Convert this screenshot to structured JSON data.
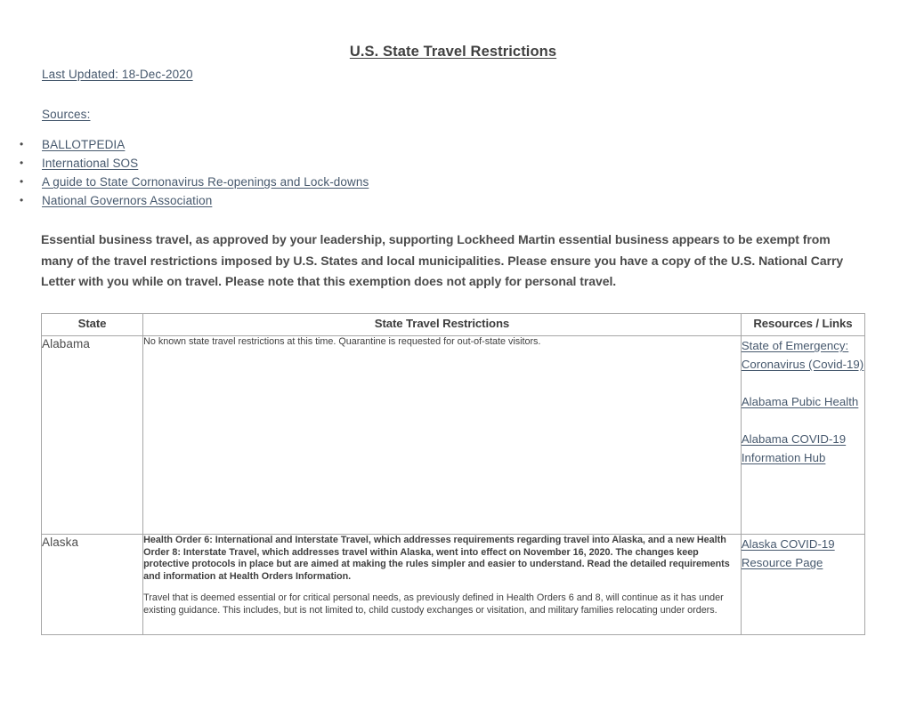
{
  "document": {
    "title": "U.S. State Travel Restrictions",
    "last_updated": "Last Updated: 18-Dec-2020",
    "sources_label": "Sources:",
    "sources": [
      {
        "label": "BALLOTPEDIA"
      },
      {
        "label": "International SOS"
      },
      {
        "label": "A guide to State Cornonavirus Re-openings and Lock-downs"
      },
      {
        "label": "National Governors Association"
      }
    ],
    "notice": "Essential business travel, as approved by your leadership, supporting Lockheed Martin essential business appears to be exempt from many of the travel restrictions imposed by U.S. States and local municipalities.  Please ensure you have a copy of the U.S. National Carry Letter with you while on travel.   Please note that this exemption does not apply for personal travel."
  },
  "table": {
    "headers": {
      "state": "State",
      "restrictions": "State Travel Restrictions",
      "resources": "Resources / Links"
    },
    "rows": [
      {
        "state": "Alabama",
        "restrictions": {
          "p1": "No known state travel restrictions at this time. Quarantine is requested for out-of-state visitors."
        },
        "links": [
          {
            "label": "State of Emergency: Coronavirus (Covid-19)"
          },
          {
            "label": "Alabama Pubic Health"
          },
          {
            "label": "Alabama COVID-19 Information Hub"
          }
        ]
      },
      {
        "state": "Alaska",
        "restrictions": {
          "p1_link1": "Health Order 6: International and Interstate Travel",
          "p1_seg1": ", which addresses requirements regarding travel into Alaska, and a new ",
          "p1_link2": "Health Order 8: Interstate Travel",
          "p1_seg2": ", which addresses travel within Alaska, went into effect on November 16, 2020. The changes keep protective protocols in place but are aimed at making the rules simpler and easier to understand. Read the detailed requirements and information at ",
          "p1_link3": "Health Orders Information.",
          "p2": "Travel that is deemed essential or for critical personal needs, as previously defined in Health Orders 6 and 8, will continue as it has under existing guidance. This includes, but is not limited to, child custody exchanges or visitation, and military families relocating under orders."
        },
        "links": [
          {
            "label": "Alaska COVID-19 Resource Page"
          }
        ]
      }
    ]
  },
  "colors": {
    "heading": "#404040",
    "link_slate": "#46586d",
    "hyperlink_blue": "#1155cc",
    "table_border": "#a6a6a6",
    "body_text": "#3f3f3f"
  }
}
